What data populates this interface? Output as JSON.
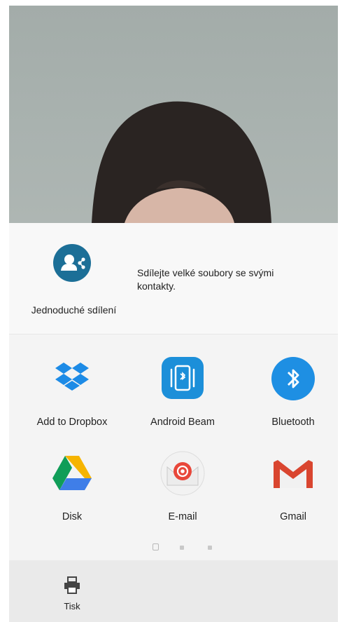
{
  "easy_share": {
    "label": "Jednoduché sdílení",
    "description": "Sdílejte velké soubory se svými kontakty.",
    "icon": "easy-share-icon"
  },
  "apps": [
    {
      "label": "Add to Dropbox",
      "icon": "dropbox-icon"
    },
    {
      "label": "Android Beam",
      "icon": "android-beam-icon"
    },
    {
      "label": "Bluetooth",
      "icon": "bluetooth-icon"
    },
    {
      "label": "Disk",
      "icon": "google-drive-icon"
    },
    {
      "label": "E-mail",
      "icon": "email-icon"
    },
    {
      "label": "Gmail",
      "icon": "gmail-icon"
    }
  ],
  "pager": {
    "pages": 3,
    "current": 1
  },
  "bottom_bar": {
    "print_label": "Tisk",
    "print_icon": "printer-icon"
  },
  "colors": {
    "easy_share_accent": "#1c6f97",
    "dropbox": "#1d8be6",
    "android_beam": "#1c8fd9",
    "bluetooth": "#1e8fe3",
    "gmail_red": "#d9452f"
  }
}
